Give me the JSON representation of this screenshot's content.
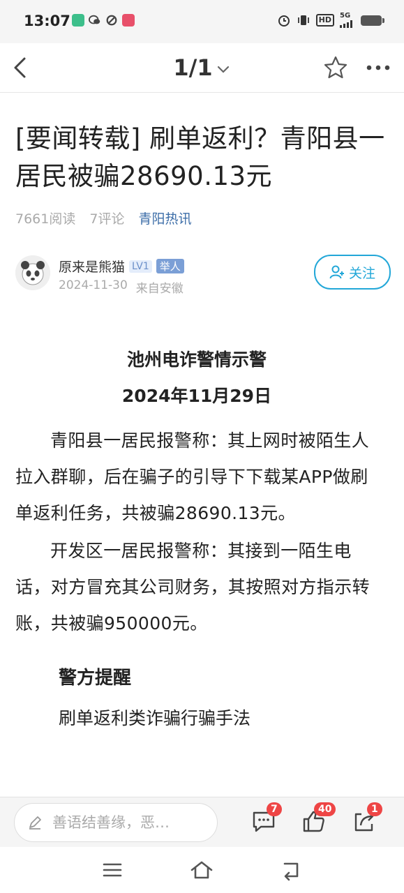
{
  "status_bar": {
    "time": "13:07",
    "network": "5G",
    "hd": "HD",
    "icons": [
      "app-notification-icon",
      "wechat-icon",
      "sync-icon",
      "app-icon",
      "alarm-icon",
      "vibrate-icon",
      "signal-icon",
      "battery-icon"
    ]
  },
  "nav": {
    "page_indicator": "1/1",
    "icons": [
      "back-icon",
      "chevron-down-icon",
      "star-icon",
      "more-icon"
    ]
  },
  "article": {
    "title": "[要闻转载] 刷单返利？青阳县一居民被骗28690.13元",
    "reads": "7661阅读",
    "comments": "7评论",
    "source": "青阳热讯",
    "author": {
      "name": "原来是熊猫",
      "level": "LV1",
      "report": "举人",
      "date": "2024-11-30",
      "location": "来自安徽",
      "follow_label": "关注"
    },
    "heading": "池州电诈警情示警",
    "date_heading": "2024年11月29日",
    "paragraphs": [
      "青阳县一居民报警称：其上网时被陌生人拉入群聊，后在骗子的引导下下载某APP做刷单返利任务，共被骗28690.13元。",
      "开发区一居民报警称：其接到一陌生电话，对方冒充其公司财务，其按照对方指示转账，共被骗950000元。"
    ],
    "alert_heading": "警方提醒",
    "cutoff_text": "刷单返利类诈骗行骗手法"
  },
  "action_bar": {
    "comment_placeholder": "善语结善缘，恶…",
    "comment_count": "7",
    "like_count": "40",
    "share_count": "1"
  },
  "colors": {
    "accent": "#22a7d8",
    "source_link": "#3d6ea8",
    "badge_red": "#ee4545",
    "level_badge": "#6b8fc9"
  }
}
